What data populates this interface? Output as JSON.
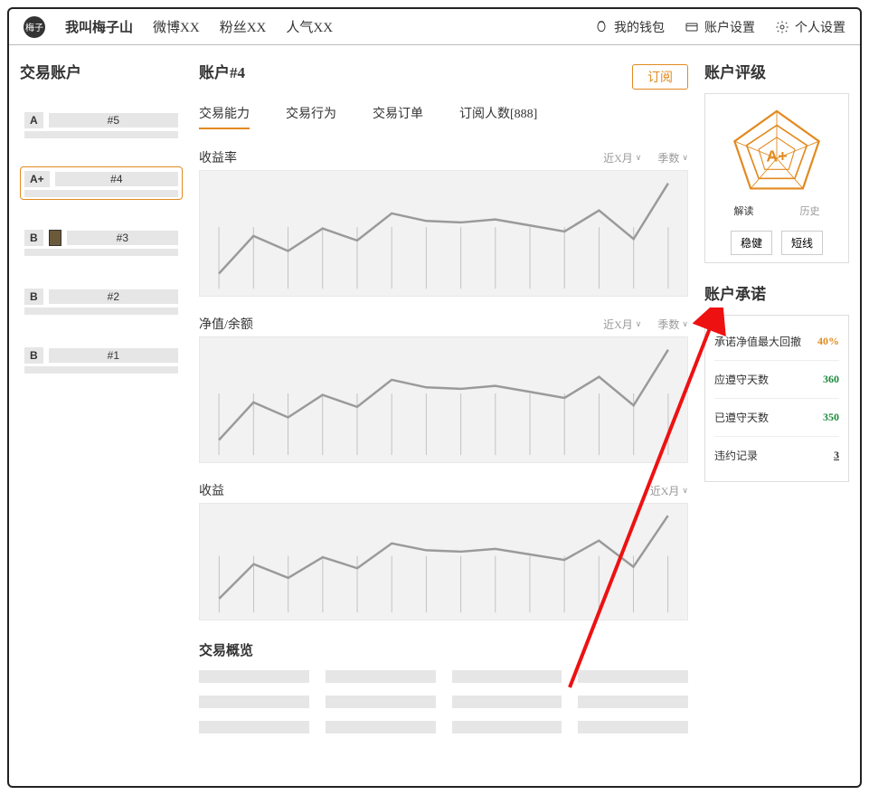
{
  "nav": {
    "logo_text": "梅子",
    "brand": "我叫梅子山",
    "links": [
      "微博XX",
      "粉丝XX",
      "人气XX"
    ],
    "right": [
      {
        "icon": "wallet-icon",
        "label": "我的钱包"
      },
      {
        "icon": "card-icon",
        "label": "账户设置"
      },
      {
        "icon": "gear-icon",
        "label": "个人设置"
      }
    ]
  },
  "sidebar": {
    "title": "交易账户",
    "accounts": [
      {
        "grade": "A",
        "name": "#5",
        "selected": false,
        "avatar": false
      },
      {
        "grade": "A+",
        "name": "#4",
        "selected": true,
        "avatar": false
      },
      {
        "grade": "B",
        "name": "#3",
        "selected": false,
        "avatar": true
      },
      {
        "grade": "B",
        "name": "#2",
        "selected": false,
        "avatar": false
      },
      {
        "grade": "B",
        "name": "#1",
        "selected": false,
        "avatar": false
      }
    ]
  },
  "center": {
    "title": "账户#4",
    "subscribe": "订阅",
    "tabs": [
      {
        "label": "交易能力",
        "active": true
      },
      {
        "label": "交易行为",
        "active": false
      },
      {
        "label": "交易订单",
        "active": false
      },
      {
        "label": "订阅人数[888]",
        "active": false
      }
    ],
    "charts": [
      {
        "title": "收益率",
        "ctrl1": "近X月",
        "ctrl2": "季数"
      },
      {
        "title": "净值/余额",
        "ctrl1": "近X月",
        "ctrl2": "季数"
      },
      {
        "title": "收益",
        "ctrl1": "近X月",
        "ctrl2": ""
      }
    ],
    "overview_title": "交易概览"
  },
  "rating": {
    "title": "账户评级",
    "grade": "A+",
    "tab1": "解读",
    "tab2": "历史",
    "btn1": "稳健",
    "btn2": "短线"
  },
  "promise": {
    "title": "账户承诺",
    "rows": [
      {
        "label": "承诺净值最大回撤",
        "value": "40%",
        "cls": "val-orange"
      },
      {
        "label": "应遵守天数",
        "value": "360",
        "cls": "val-green"
      },
      {
        "label": "已遵守天数",
        "value": "350",
        "cls": "val-green"
      },
      {
        "label": "违约记录",
        "value": "3",
        "cls": "val-underline"
      }
    ]
  },
  "chart_data": [
    {
      "type": "line",
      "title": "收益率",
      "x": [
        1,
        2,
        3,
        4,
        5,
        6,
        7,
        8,
        9,
        10,
        11,
        12,
        13,
        14
      ],
      "values": [
        10,
        35,
        25,
        40,
        32,
        50,
        45,
        44,
        46,
        42,
        38,
        52,
        33,
        70
      ],
      "grid": true
    },
    {
      "type": "line",
      "title": "净值/余额",
      "x": [
        1,
        2,
        3,
        4,
        5,
        6,
        7,
        8,
        9,
        10,
        11,
        12,
        13,
        14
      ],
      "values": [
        10,
        35,
        25,
        40,
        32,
        50,
        45,
        44,
        46,
        42,
        38,
        52,
        33,
        70
      ],
      "grid": true
    },
    {
      "type": "line",
      "title": "收益",
      "x": [
        1,
        2,
        3,
        4,
        5,
        6,
        7,
        8,
        9,
        10,
        11,
        12,
        13,
        14
      ],
      "values": [
        10,
        35,
        25,
        40,
        32,
        50,
        45,
        44,
        46,
        42,
        38,
        52,
        33,
        70
      ],
      "grid": true
    }
  ]
}
